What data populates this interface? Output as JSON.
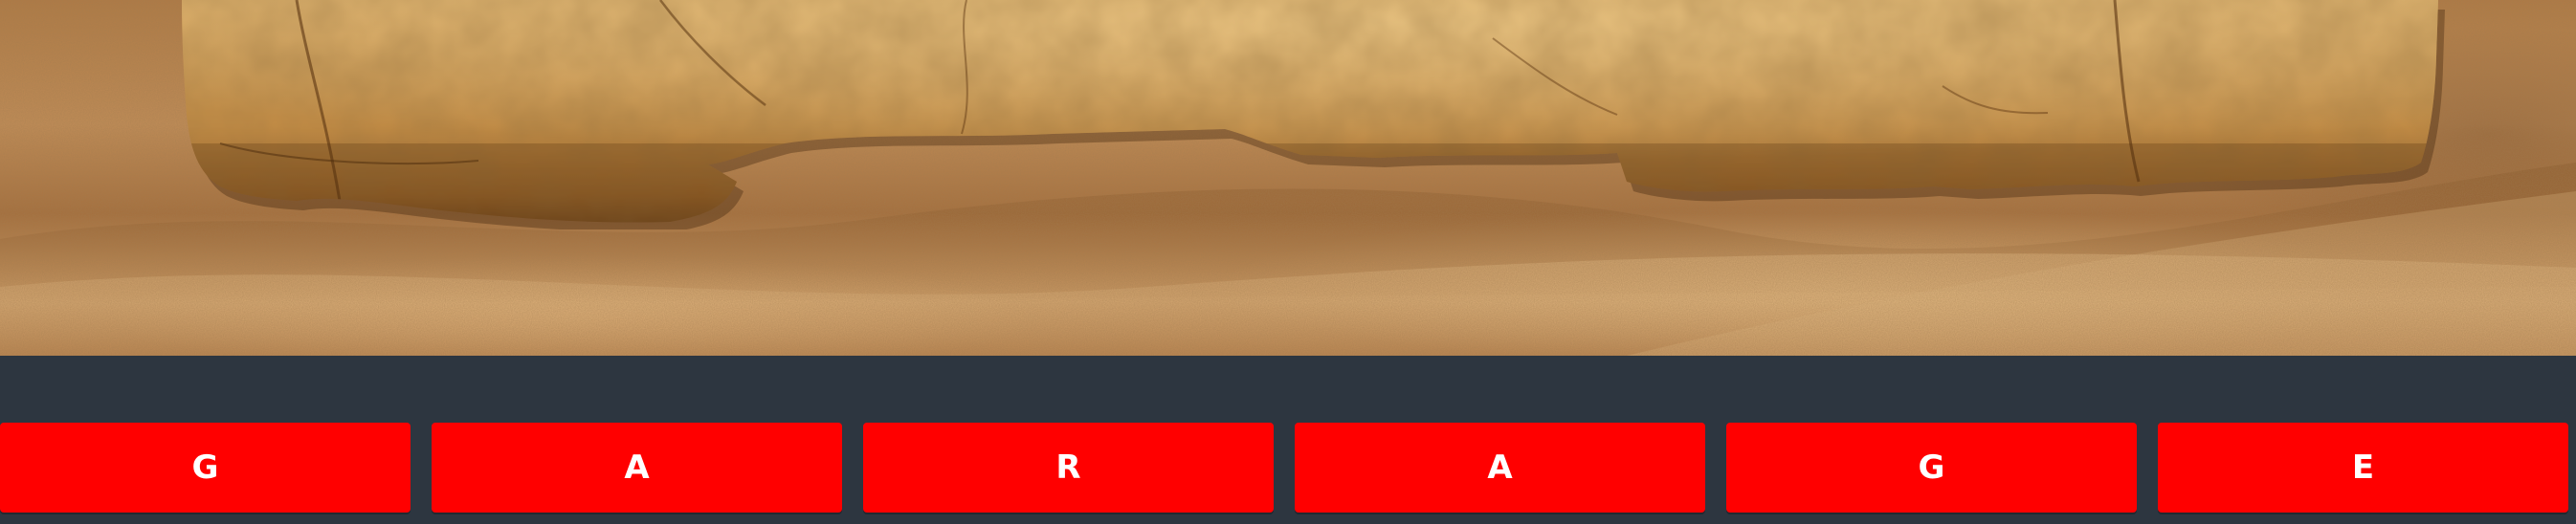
{
  "letter_tiles": [
    {
      "letter": "G"
    },
    {
      "letter": "A"
    },
    {
      "letter": "R"
    },
    {
      "letter": "A"
    },
    {
      "letter": "G"
    },
    {
      "letter": "E"
    }
  ],
  "colors": {
    "tile_background": "#ff0000",
    "tile_text": "#ffffff",
    "bar_background": "#2d3640",
    "sand": "#c28d57",
    "parchment": "#c9974e"
  }
}
